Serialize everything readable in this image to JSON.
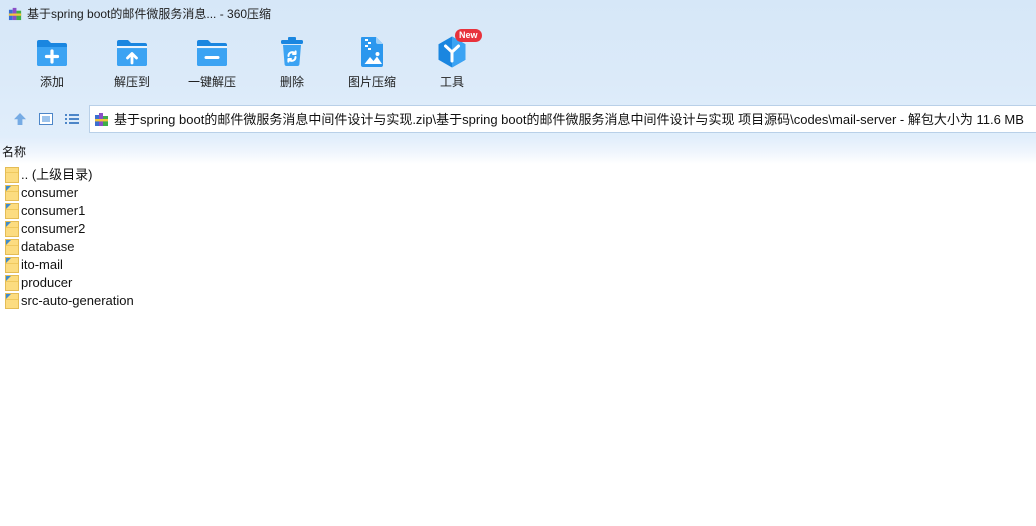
{
  "window": {
    "title": "基于spring boot的邮件微服务消息... - 360压缩",
    "app_icon": "app-logo-icon"
  },
  "toolbar": {
    "items": [
      {
        "label": "添加",
        "icon": "add-icon"
      },
      {
        "label": "解压到",
        "icon": "extract-to-icon"
      },
      {
        "label": "一键解压",
        "icon": "one-click-extract-icon"
      },
      {
        "label": "删除",
        "icon": "delete-icon"
      },
      {
        "label": "图片压缩",
        "icon": "image-compress-icon"
      },
      {
        "label": "工具",
        "icon": "tools-icon",
        "badge": "New"
      }
    ]
  },
  "nav": {
    "up_icon": "arrow-up-icon",
    "view_icon": "thumbnail-view-icon",
    "list_icon": "list-view-icon"
  },
  "address": {
    "icon": "archive-icon",
    "path": "基于spring boot的邮件微服务消息中间件设计与实现.zip\\基于spring boot的邮件微服务消息中间件设计与实现 项目源码\\codes\\mail-server - 解包大小为 11.6 MB"
  },
  "list": {
    "column_name": "名称",
    "items": [
      {
        "name": ".. (上级目录)",
        "icon": "folder-up-icon"
      },
      {
        "name": "consumer",
        "icon": "folder-icon"
      },
      {
        "name": "consumer1",
        "icon": "folder-icon"
      },
      {
        "name": "consumer2",
        "icon": "folder-icon"
      },
      {
        "name": "database",
        "icon": "folder-icon"
      },
      {
        "name": "ito-mail",
        "icon": "folder-icon"
      },
      {
        "name": "producer",
        "icon": "folder-icon"
      },
      {
        "name": "src-auto-generation",
        "icon": "folder-icon"
      }
    ]
  },
  "colors": {
    "accent": "#1a86e0",
    "accent_light": "#3ba3f3",
    "toolbar_bg": "#d6e7f8",
    "badge": "#e8323c",
    "folder": "#fcdc80"
  }
}
